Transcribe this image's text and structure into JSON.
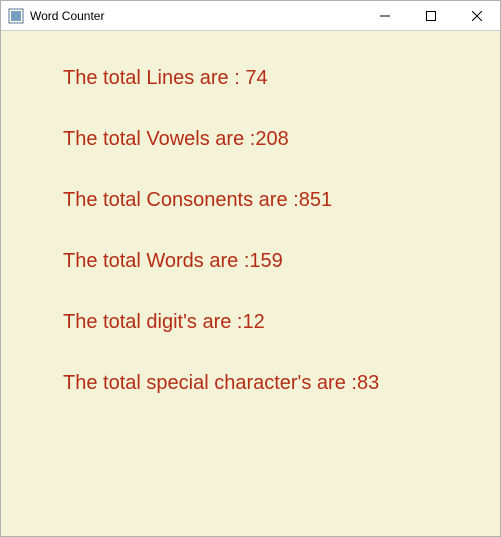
{
  "window": {
    "title": "Word Counter"
  },
  "stats": {
    "lines_label": "The total Lines are : ",
    "lines_value": "74",
    "vowels_label": "The total Vowels are :",
    "vowels_value": "208",
    "consonants_label": "The total Consonents are :",
    "consonants_value": "851",
    "words_label": "The total Words are :",
    "words_value": "159",
    "digits_label": "The total digit's are :",
    "digits_value": "12",
    "special_label": "The total special character's are :",
    "special_value": "83"
  }
}
